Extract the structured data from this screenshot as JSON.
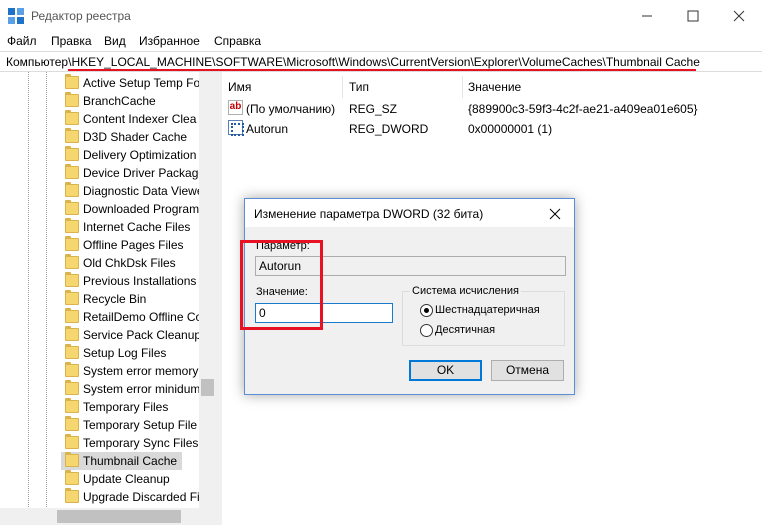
{
  "window": {
    "title": "Редактор реестра"
  },
  "menu": [
    "Файл",
    "Правка",
    "Вид",
    "Избранное",
    "Справка"
  ],
  "address": "Компьютер\\HKEY_LOCAL_MACHINE\\SOFTWARE\\Microsoft\\Windows\\CurrentVersion\\Explorer\\VolumeCaches\\Thumbnail Cache",
  "tree": {
    "items": [
      "Active Setup Temp Fo",
      "BranchCache",
      "Content Indexer Clea",
      "D3D Shader Cache",
      "Delivery Optimization",
      "Device Driver Package",
      "Diagnostic Data Viewe",
      "Downloaded Program",
      "Internet Cache Files",
      "Offline Pages Files",
      "Old ChkDsk Files",
      "Previous Installations",
      "Recycle Bin",
      "RetailDemo Offline Co",
      "Service Pack Cleanup",
      "Setup Log Files",
      "System error memory",
      "System error minidum",
      "Temporary Files",
      "Temporary Setup File",
      "Temporary Sync Files",
      "Thumbnail Cache",
      "Update Cleanup",
      "Upgrade Discarded Fil"
    ],
    "selected_index": 21
  },
  "list": {
    "columns": [
      "Имя",
      "Тип",
      "Значение"
    ],
    "rows": [
      {
        "icon": "string-value-icon",
        "icon_text": "ab",
        "name": "(По умолчанию)",
        "type": "REG_SZ",
        "value": "{889900c3-59f3-4c2f-ae21-a409ea01e605}"
      },
      {
        "icon": "binary-value-icon",
        "name": "Autorun",
        "type": "REG_DWORD",
        "value": "0x00000001 (1)"
      }
    ]
  },
  "dialog": {
    "title": "Изменение параметра DWORD (32 бита)",
    "param_label": "Параметр:",
    "param_value": "Autorun",
    "value_label": "Значение:",
    "value": "0",
    "base_legend": "Система исчисления",
    "radio_hex": "Шестнадцатеричная",
    "radio_dec": "Десятичная",
    "selected_base": "hex",
    "ok": "OK",
    "cancel": "Отмена"
  },
  "colors": {
    "highlight": "#e81123",
    "folder": "#f6d66f",
    "accent": "#0078d7"
  }
}
